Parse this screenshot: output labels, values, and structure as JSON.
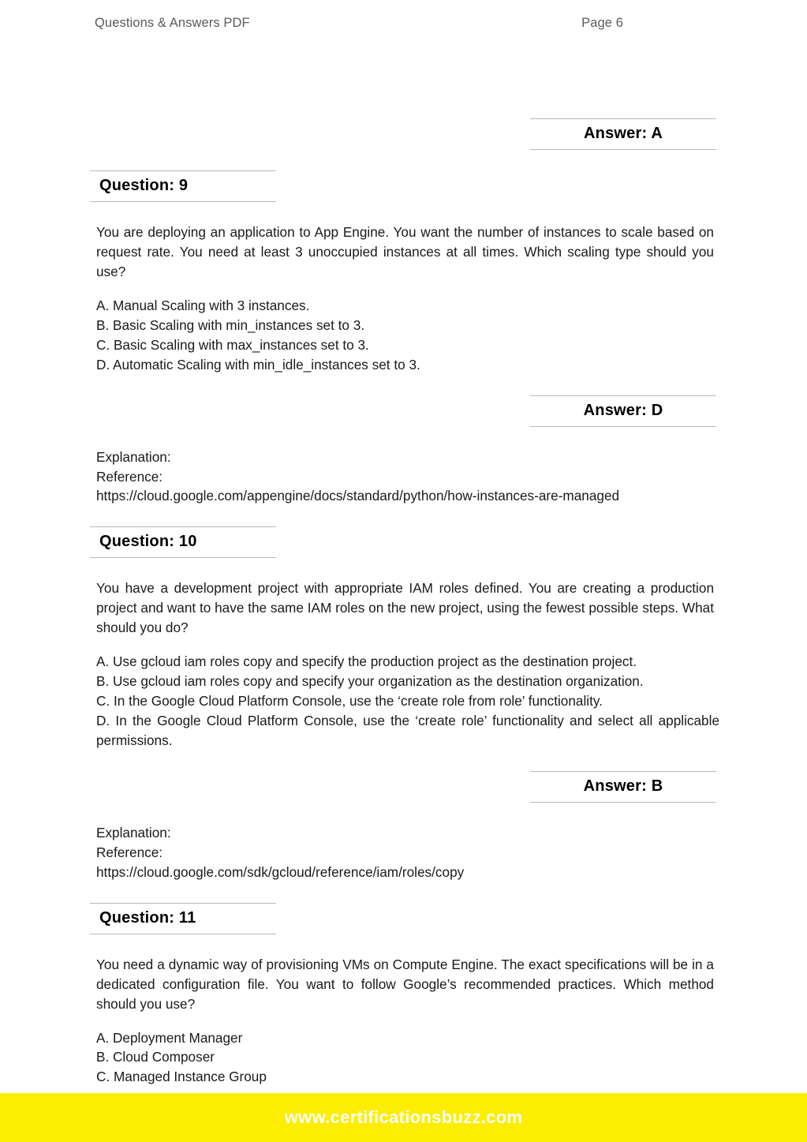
{
  "header": {
    "left": "Questions & Answers PDF",
    "right": "Page 6"
  },
  "blocks": {
    "answer_prev": "Answer: A",
    "q9": {
      "heading": "Question: 9",
      "body": "You are deploying an application to App Engine. You want the number of instances to scale based on request rate. You need at least 3 unoccupied instances at all times. Which scaling type should you use?",
      "options": [
        "A. Manual Scaling with 3 instances.",
        "B. Basic Scaling with min_instances set to 3.",
        "C. Basic Scaling with max_instances set to 3.",
        "D. Automatic Scaling with min_idle_instances set to 3."
      ],
      "answer": "Answer: D",
      "explanation_label": "Explanation:",
      "reference_label": "Reference:",
      "reference_url": "https://cloud.google.com/appengine/docs/standard/python/how-instances-are-managed"
    },
    "q10": {
      "heading": "Question: 10",
      "body": "You have a development project with appropriate IAM roles defined. You are creating a production project and want to have the same IAM roles on the new project, using the fewest possible steps. What should you do?",
      "options": [
        "A. Use gcloud iam roles copy and specify the production project as the destination project.",
        "B. Use gcloud iam roles copy and specify your organization as the destination organization.",
        "C. In the Google Cloud Platform Console, use the ‘create role from role’ functionality.",
        "D. In the Google Cloud Platform Console, use the ‘create role’ functionality and select all applicable permissions."
      ],
      "answer": "Answer: B",
      "explanation_label": "Explanation:",
      "reference_label": "Reference:",
      "reference_url": "https://cloud.google.com/sdk/gcloud/reference/iam/roles/copy"
    },
    "q11": {
      "heading": "Question: 11",
      "body": "You need a dynamic way of provisioning VMs on Compute Engine. The exact specifications will be in a dedicated configuration file. You want to follow Google’s recommended practices. Which method should you use?",
      "options": [
        "A. Deployment Manager",
        "B. Cloud Composer",
        "C. Managed Instance Group"
      ]
    }
  },
  "footer": {
    "site": "www.certificationsbuzz.com",
    "background_color": "#fdee00",
    "text_color": "#ffffff"
  }
}
